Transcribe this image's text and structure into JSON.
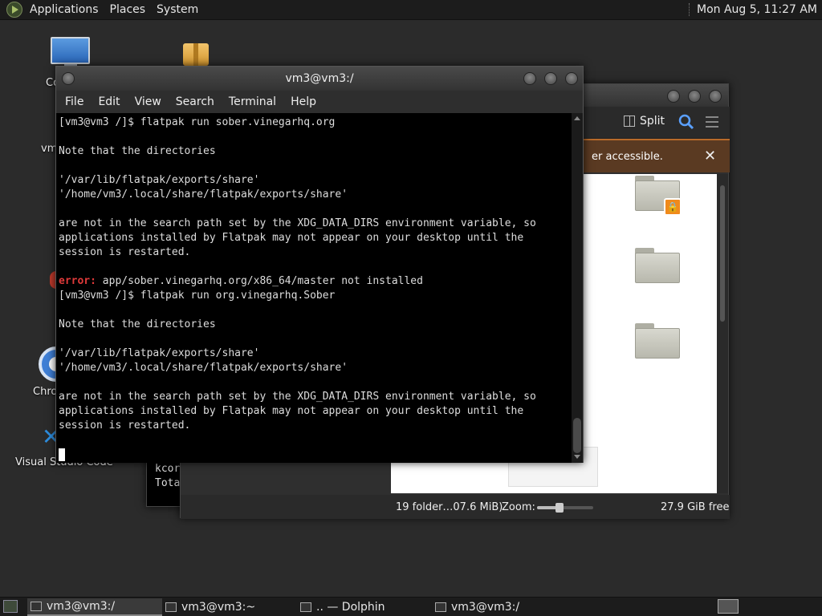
{
  "top_panel": {
    "menus": [
      "Applications",
      "Places",
      "System"
    ],
    "clock": "Mon Aug  5, 11:27 AM"
  },
  "desktop": {
    "icons": [
      {
        "label": "Co"
      },
      {
        "label": "vm"
      },
      {
        "label": "Chro"
      },
      {
        "label": "Visual Studio Code"
      }
    ]
  },
  "back_terminal": {
    "lines": [
      "kcor",
      "Tota"
    ]
  },
  "dolphin": {
    "split_label": "Split",
    "notice": "er accessible.",
    "close_glyph": "✕",
    "status_count": "19 folder…07.6 MiB)",
    "zoom_label": "Zoom:",
    "zoom_level": 0.4,
    "free_space": "27.9 GiB free"
  },
  "terminal": {
    "title": "vm3@vm3:/",
    "menus": [
      "File",
      "Edit",
      "View",
      "Search",
      "Terminal",
      "Help"
    ],
    "lines": [
      "[vm3@vm3 /]$ flatpak run sober.vinegarhq.org",
      "",
      "Note that the directories",
      "",
      "'/var/lib/flatpak/exports/share'",
      "'/home/vm3/.local/share/flatpak/exports/share'",
      "",
      "are not in the search path set by the XDG_DATA_DIRS environment variable, so",
      "applications installed by Flatpak may not appear on your desktop until the",
      "session is restarted.",
      "",
      "app/sober.vinegarhq.org/x86_64/master not installed",
      "[vm3@vm3 /]$ flatpak run org.vinegarhq.Sober",
      "",
      "Note that the directories",
      "",
      "'/var/lib/flatpak/exports/share'",
      "'/home/vm3/.local/share/flatpak/exports/share'",
      "",
      "are not in the search path set by the XDG_DATA_DIRS environment variable, so",
      "applications installed by Flatpak may not appear on your desktop until the",
      "session is restarted.",
      ""
    ],
    "error_prefix": "error:"
  },
  "taskbar": {
    "tasks": [
      {
        "label": "vm3@vm3:/",
        "active": true
      },
      {
        "label": "vm3@vm3:~",
        "active": false
      },
      {
        "label": ".. — Dolphin",
        "active": false
      },
      {
        "label": "vm3@vm3:/",
        "active": false
      }
    ]
  }
}
